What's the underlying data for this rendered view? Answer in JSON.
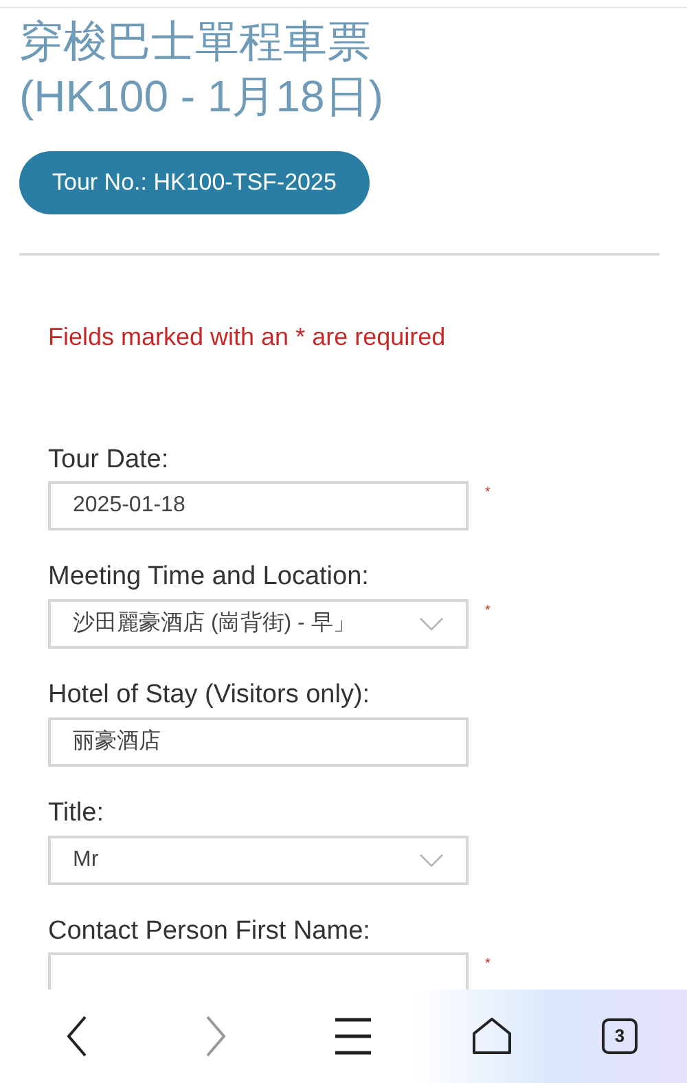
{
  "page": {
    "title_lines": [
      "穿梭巴士單程車票",
      "(HK100 - 1月18日)"
    ],
    "tour_button": "Tour No.: HK100-TSF-2025",
    "required_note": "Fields marked with an * are required"
  },
  "fields": [
    {
      "label": "Tour Date:",
      "kind": "text",
      "value": "2025-01-18",
      "required": true
    },
    {
      "label": "Meeting Time and Location:",
      "kind": "select",
      "value": "沙田麗豪酒店 (崗背街) - 早」",
      "required": true
    },
    {
      "label": "Hotel of Stay (Visitors only):",
      "kind": "text",
      "value": "丽豪酒店",
      "required": false
    },
    {
      "label": "Title:",
      "kind": "select",
      "value": "Mr",
      "required": false
    },
    {
      "label": "Contact Person First Name:",
      "kind": "text",
      "required": true
    }
  ],
  "required_mark": "*",
  "browser_nav": {
    "back_disabled": false,
    "forward_disabled": true,
    "tab_count": "3"
  }
}
